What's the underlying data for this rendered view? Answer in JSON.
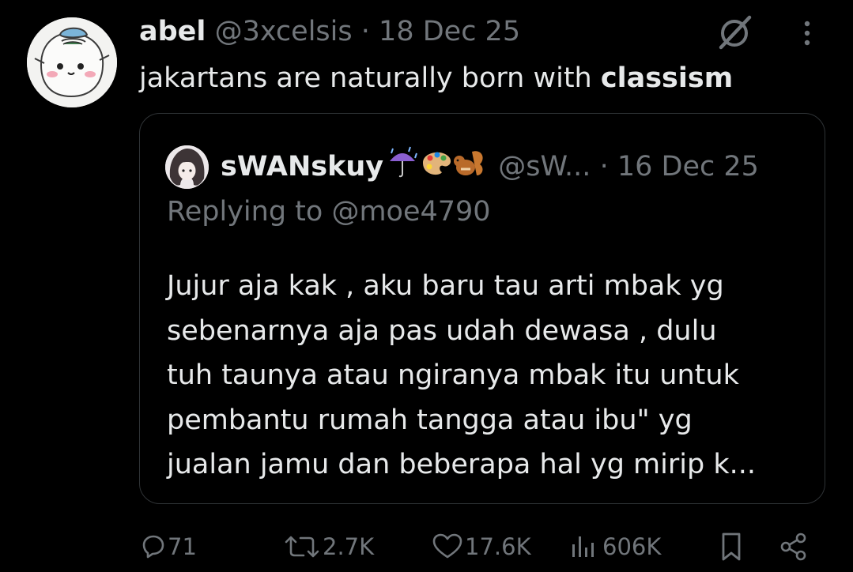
{
  "tweet": {
    "author": {
      "name": "abel",
      "handle": "@3xcelsis"
    },
    "separator": "·",
    "date": "18 Dec 25",
    "text_before": "jakartans are naturally born with ",
    "text_bold": "classism",
    "icons": {
      "grok": "grok-icon",
      "more": "more-dots-icon"
    }
  },
  "quote": {
    "author": {
      "name": "sWANskuy",
      "emojis": [
        "umbrella-rain-emoji",
        "palette-emoji",
        "chipmunk-emoji"
      ],
      "handle": "@sW..."
    },
    "separator": "·",
    "date": "16 Dec 25",
    "replying_to": "Replying to @moe4790",
    "body_lines": [
      "Jujur aja kak , aku baru tau arti mbak yg",
      "sebenarnya aja pas udah dewasa , dulu",
      "tuh taunya atau ngiranya mbak itu untuk",
      "pembantu rumah tangga atau ibu\" yg",
      "jualan jamu dan beberapa hal yg mirip k..."
    ]
  },
  "actions": {
    "replies": "71",
    "reposts": "2.7K",
    "likes": "17.6K",
    "views": "606K",
    "icons": {
      "reply": "reply-icon",
      "repost": "repost-icon",
      "like": "heart-icon",
      "views": "views-icon",
      "bookmark": "bookmark-icon",
      "share": "share-icon"
    }
  },
  "colors": {
    "background": "#000000",
    "primary_text": "#e7e9ea",
    "secondary_text": "#71767b",
    "border": "#2f3336"
  }
}
